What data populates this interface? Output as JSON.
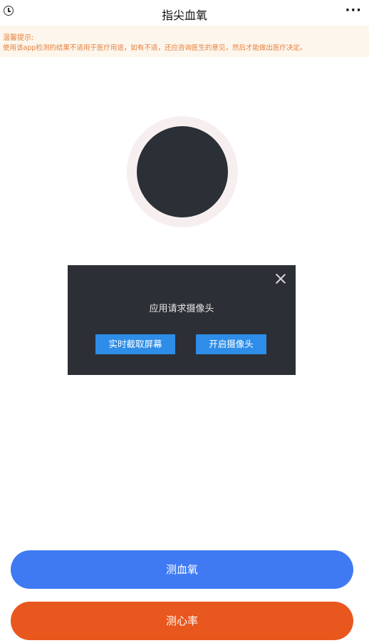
{
  "header": {
    "title": "指尖血氧",
    "more_label": "···"
  },
  "notice": {
    "title": "温馨提示:",
    "body": "使用该app检测的结果不适用于医疗用途，如有不适，还应咨询医生的意见，然后才能做出医疗决定。"
  },
  "dialog": {
    "message": "应用请求摄像头",
    "screen_capture_label": "实时截取屏幕",
    "open_camera_label": "开启摄像头"
  },
  "actions": {
    "measure_spo2_label": "测血氧",
    "measure_heart_rate_label": "测心率"
  },
  "colors": {
    "notice_text": "#e67e3a",
    "notice_bg": "#fdf6ec",
    "dialog_bg": "#2c2f35",
    "dialog_button": "#2d8de8",
    "spo2_button": "#3f7af3",
    "heart_rate_button": "#e8571e"
  },
  "icons": {
    "history": "clock-icon",
    "more": "more-icon",
    "close": "close-icon"
  }
}
